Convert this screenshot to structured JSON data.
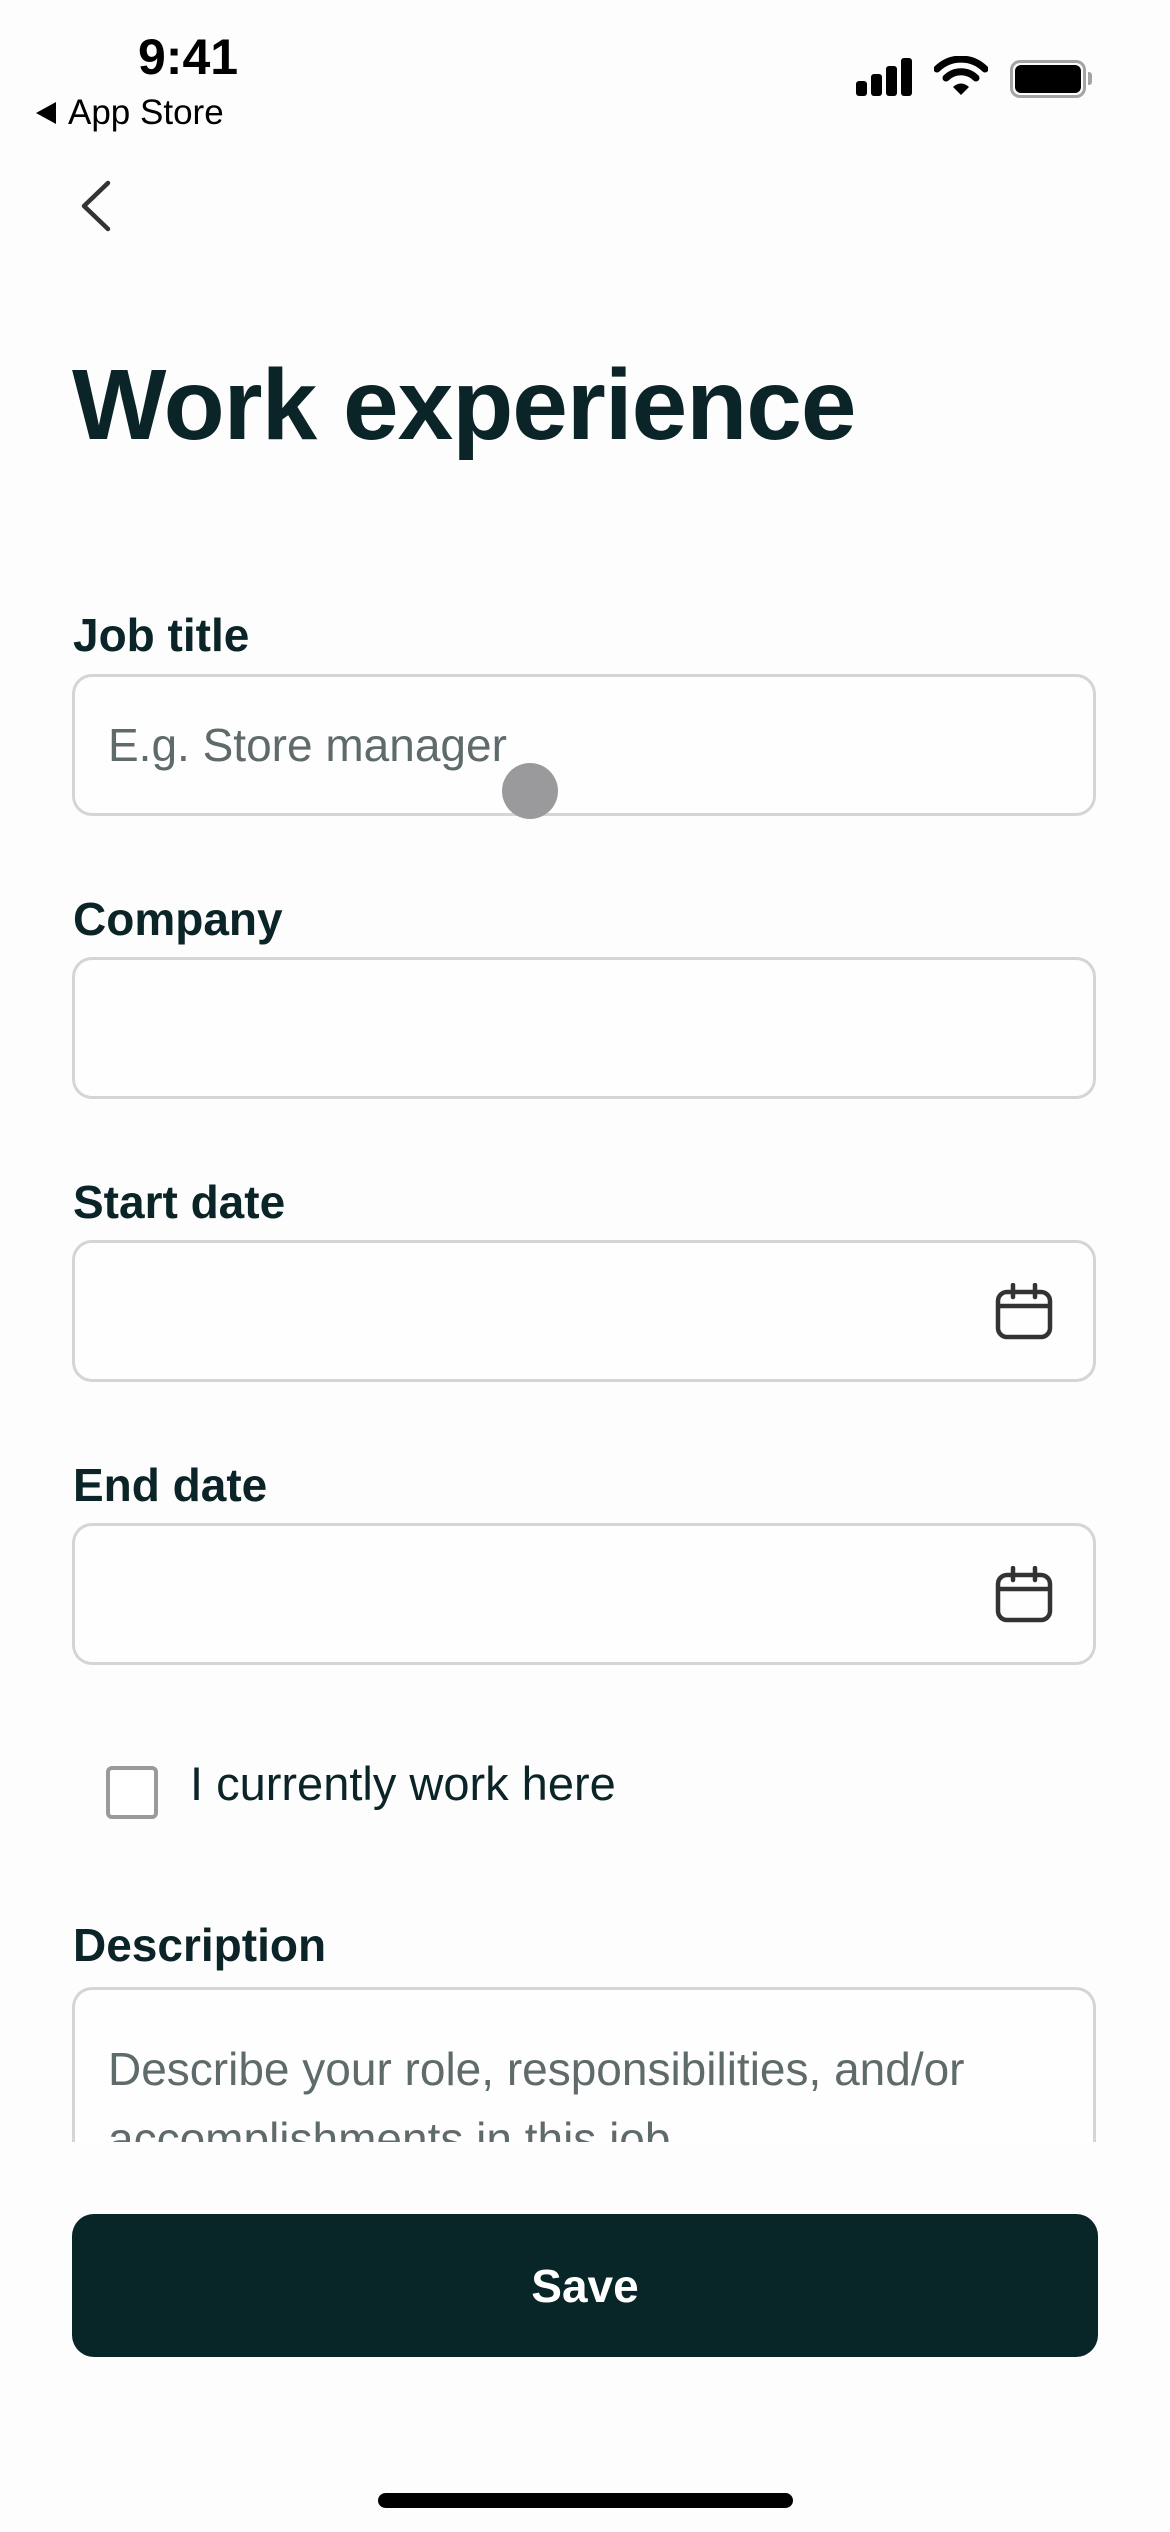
{
  "status_bar": {
    "time": "9:41",
    "back_app_label": "App Store",
    "icons": [
      "signal-icon",
      "wifi-icon",
      "battery-icon"
    ]
  },
  "nav": {
    "back_icon": "chevron-left-icon"
  },
  "page": {
    "title": "Work experience"
  },
  "form": {
    "job_title": {
      "label": "Job title",
      "value": "",
      "placeholder": "E.g. Store manager"
    },
    "company": {
      "label": "Company",
      "value": "",
      "placeholder": ""
    },
    "start_date": {
      "label": "Start date",
      "value": "",
      "icon": "calendar-icon"
    },
    "end_date": {
      "label": "End date",
      "value": "",
      "icon": "calendar-icon"
    },
    "currently_work_here": {
      "label": "I currently work here",
      "checked": false
    },
    "description": {
      "label": "Description",
      "value": "",
      "placeholder": "Describe your role, responsibilities, and/or accomplishments in this job"
    }
  },
  "actions": {
    "save_label": "Save"
  },
  "colors": {
    "primary": "#082528",
    "text": "#0b2427",
    "placeholder": "#5f6a6b",
    "border": "#d5d5d5",
    "background": "#fdfdfd"
  }
}
